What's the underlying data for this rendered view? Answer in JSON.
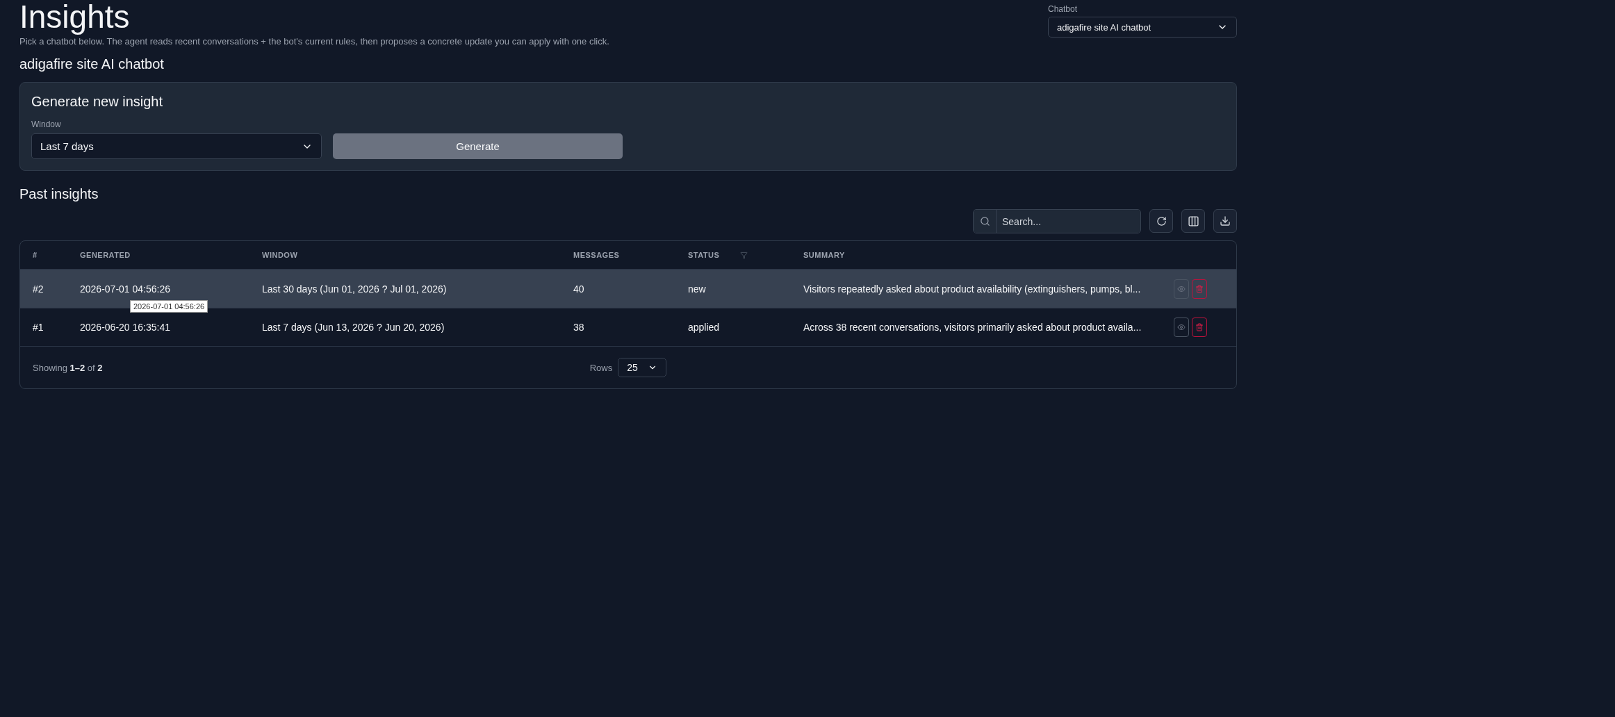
{
  "header": {
    "title": "Insights",
    "subtitle": "Pick a chatbot below. The agent reads recent conversations + the bot's current rules, then proposes a concrete update you can apply with one click."
  },
  "chatbot_picker": {
    "label": "Chatbot",
    "value": "adigafire site AI chatbot"
  },
  "bot_name": "adigafire site AI chatbot",
  "generate_card": {
    "title": "Generate new insight",
    "window_label": "Window",
    "window_value": "Last 7 days",
    "button": "Generate"
  },
  "past_insights": {
    "title": "Past insights",
    "search": {
      "placeholder": "Search..."
    },
    "table": {
      "columns": [
        {
          "label": "#",
          "filter": false
        },
        {
          "label": "GENERATED",
          "filter": false
        },
        {
          "label": "WINDOW",
          "filter": false
        },
        {
          "label": "MESSAGES",
          "filter": false
        },
        {
          "label": "STATUS",
          "filter": true
        },
        {
          "label": "SUMMARY",
          "filter": false
        }
      ],
      "rows": [
        {
          "selected": true,
          "cells": [
            "#2",
            "2026-07-01 04:56:26",
            "Last 30 days (Jun 01, 2026 ? Jul 01, 2026)",
            "40",
            "new",
            "Visitors repeatedly asked about product availability (extinguishers, pumps, bl..."
          ],
          "tooltip": "2026-07-01 04:56:26"
        },
        {
          "selected": false,
          "cells": [
            "#1",
            "2026-06-20 16:35:41",
            "Last 7 days (Jun 13, 2026 ? Jun 20, 2026)",
            "38",
            "applied",
            "Across 38 recent conversations, visitors primarily asked about product availa..."
          ]
        }
      ],
      "footer": {
        "showing": "Showing **1–2** of **2**",
        "rows_label": "Rows",
        "rows_value": "25"
      }
    }
  }
}
